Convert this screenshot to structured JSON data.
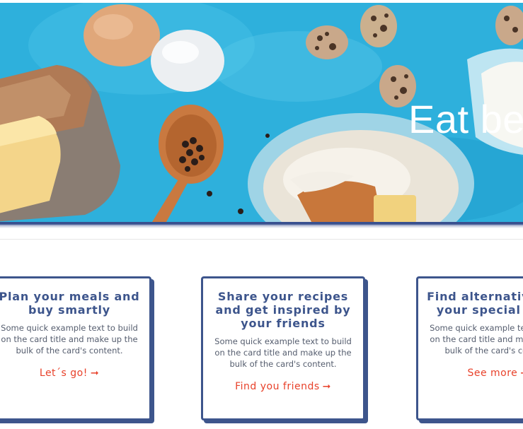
{
  "hero": {
    "title": "Eat better",
    "background_color": "#2fb3de"
  },
  "cards": [
    {
      "title": "Plan your meals and buy smartly",
      "text": "Some quick example text to build on the card title and make up the bulk of the card's content.",
      "link": "Let´s go!",
      "link_icon": "arrow-right-icon"
    },
    {
      "title": "Share your recipes and get inspired by your friends",
      "text": "Some quick example text to build on the card title and make up the bulk of the card's content.",
      "link": "Find you friends",
      "link_icon": "arrow-right-icon"
    },
    {
      "title": "Find alternatives for your special diets",
      "text": "Some quick example text to build on the card title and make up the bulk of the card's content.",
      "link": "See more",
      "link_icon": "arrow-right-icon"
    }
  ],
  "colors": {
    "card_border": "#3d558c",
    "title": "#3d558c",
    "link": "#e8412a"
  }
}
